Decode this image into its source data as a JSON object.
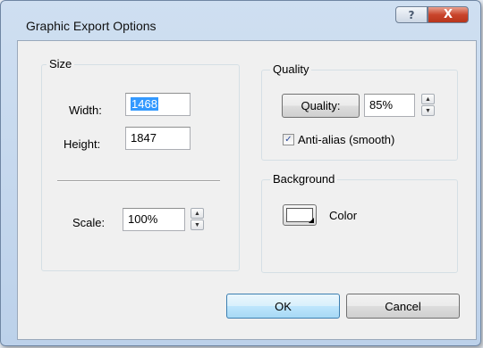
{
  "window": {
    "title": "Graphic Export Options",
    "help_glyph": "?",
    "close_glyph": "X"
  },
  "size_group": {
    "label": "Size",
    "width_label": "Width:",
    "width_value": "1468",
    "height_label": "Height:",
    "height_value": "1847",
    "scale_label": "Scale:",
    "scale_value": "100%"
  },
  "quality_group": {
    "label": "Quality",
    "quality_button": "Quality:",
    "quality_value": "85%",
    "antialias_label": "Anti-alias (smooth)",
    "antialias_checked": true
  },
  "background_group": {
    "label": "Background",
    "color_label": "Color",
    "swatch_color": "#ffffff"
  },
  "buttons": {
    "ok": "OK",
    "cancel": "Cancel"
  },
  "icons": {
    "spin_up": "▲",
    "spin_down": "▼",
    "check": "✓"
  }
}
